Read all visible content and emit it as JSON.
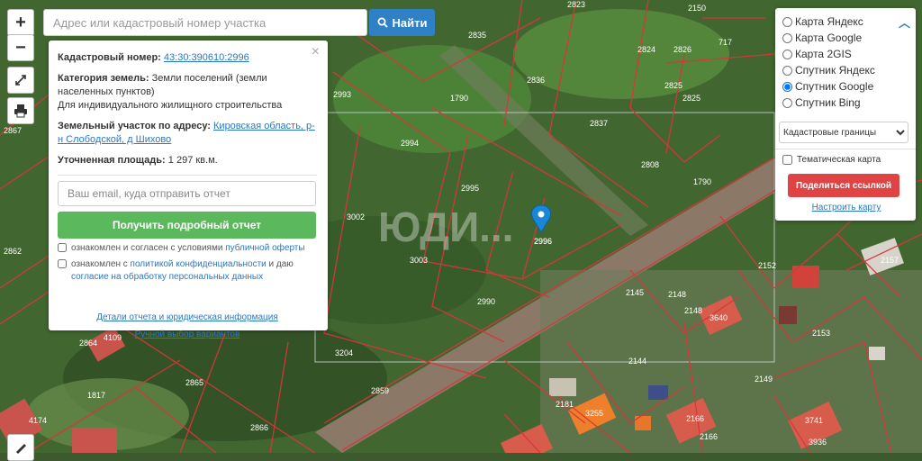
{
  "toolbar": {
    "zoom_in": "+",
    "zoom_out": "−"
  },
  "search": {
    "placeholder": "Адрес или кадастровый номер участка",
    "button_label": "Найти"
  },
  "info_panel": {
    "close": "×",
    "cadastral_label": "Кадастровый номер:",
    "cadastral_value": "43:30:390610:2996",
    "category_label": "Категория земель:",
    "category_value": "Земли поселений (земли населенных пунктов)",
    "usage_value": "Для индивидуального жилищного строительства",
    "address_label": "Земельный участок по адресу:",
    "address_value": "Кировская область, р-н Слободской, д Шихово",
    "area_label": "Уточненная площадь:",
    "area_value": "1 297 кв.м.",
    "email_placeholder": "Ваш email, куда отправить отчет",
    "report_button": "Получить подробный отчет",
    "consent1_prefix": "ознакомлен и согласен с условиями",
    "consent1_link": "публичной оферты",
    "consent2_prefix": "ознакомлен с",
    "consent2_link1": "политикой конфиденциальности",
    "consent2_mid": "и даю",
    "consent2_link2": "согласие на обработку персональных данных",
    "details_link": "Детали отчета и юридическая информация",
    "manual_link": "Ручной выбор вариантов"
  },
  "layers_panel": {
    "options": [
      "Карта Яндекс",
      "Карта Google",
      "Карта 2GIS",
      "Спутник Яндекс",
      "Спутник Google",
      "Спутник Bing"
    ],
    "selected": "Спутник Google",
    "select_value": "Кадастровые границы",
    "thematic_label": "Тематическая карта",
    "share_button": "Поделиться ссылкой",
    "setup_link": "Настроить карту"
  },
  "map": {
    "watermark": "ЮДИ...",
    "marker_label": "2996",
    "parcels": [
      "2823",
      "2835",
      "2836",
      "2824",
      "2825",
      "717",
      "2837",
      "2993",
      "1790",
      "2994",
      "2808",
      "2995",
      "1790",
      "3002",
      "2996",
      "3003",
      "2990",
      "2145",
      "2148",
      "2152",
      "2157",
      "2148",
      "3640",
      "2153",
      "2144",
      "2149",
      "3204",
      "2859",
      "2865",
      "2866",
      "1817",
      "2864",
      "4109",
      "4174",
      "2867",
      "2862",
      "2181",
      "3255",
      "2166",
      "2166",
      "3741",
      "3936",
      "2150",
      "2826",
      "2825"
    ]
  },
  "colors": {
    "accent_blue": "#2f80c4",
    "report_green": "#5cb85c",
    "share_red": "#e04343",
    "parcel_line": "#d8363a"
  }
}
